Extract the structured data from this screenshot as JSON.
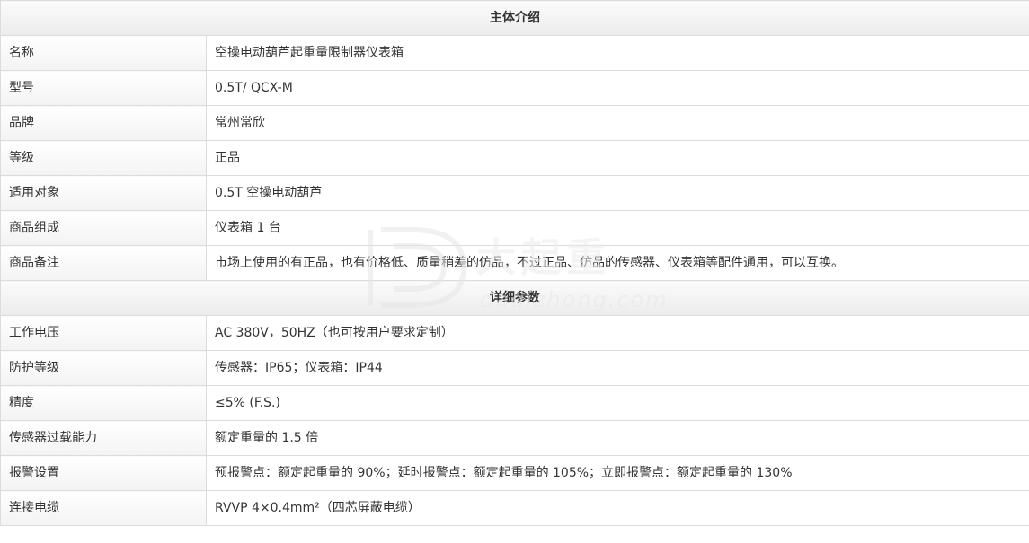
{
  "sections": {
    "intro_title": "主体介绍",
    "params_title": "详细参数"
  },
  "intro_rows": [
    {
      "label": "名称",
      "value": "空操电动葫芦起重量限制器仪表箱"
    },
    {
      "label": "型号",
      "value": "0.5T/ QCX-M"
    },
    {
      "label": "品牌",
      "value": "常州常欣"
    },
    {
      "label": "等级",
      "value": "正品"
    },
    {
      "label": "适用对象",
      "value": "0.5T 空操电动葫芦"
    },
    {
      "label": "商品组成",
      "value": "仪表箱 1 台"
    },
    {
      "label": "商品备注",
      "value": "市场上使用的有正品，也有价格低、质量稍差的仿品，不过正品、仿品的传感器、仪表箱等配件通用，可以互换。"
    }
  ],
  "param_rows": [
    {
      "label": "工作电压",
      "value": "AC 380V，50HZ（也可按用户要求定制）"
    },
    {
      "label": "防护等级",
      "value": "传感器：IP65；仪表箱：IP44"
    },
    {
      "label": "精度",
      "value": "≤5% (F.S.)"
    },
    {
      "label": "传感器过载能力",
      "value": "额定重量的 1.5 倍"
    },
    {
      "label": "报警设置",
      "value": "预报警点：额定起重量的 90%；延时报警点：额定起重量的 105%；立即报警点：额定起重量的 130%"
    },
    {
      "label": "连接电缆",
      "value": "RVVP 4×0.4mm²（四芯屏蔽电缆）"
    }
  ],
  "watermark": {
    "text_main": "大起重",
    "text_url": "daqizhong.com"
  }
}
